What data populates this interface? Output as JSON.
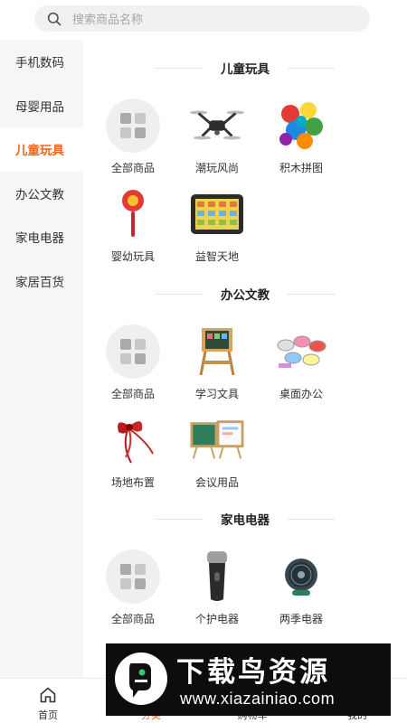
{
  "search": {
    "placeholder": "搜索商品名称",
    "icon": "search-icon"
  },
  "sidebar": {
    "items": [
      {
        "label": "手机数码"
      },
      {
        "label": "母婴用品"
      },
      {
        "label": "儿童玩具",
        "active": true
      },
      {
        "label": "办公文教"
      },
      {
        "label": "家电电器"
      },
      {
        "label": "家居百货"
      }
    ]
  },
  "sections": [
    {
      "title": "儿童玩具",
      "items": [
        {
          "label": "全部商品",
          "icon": "grid-icon"
        },
        {
          "label": "潮玩风尚",
          "icon": "drone-image"
        },
        {
          "label": "积木拼图",
          "icon": "blocks-image"
        },
        {
          "label": "婴幼玩具",
          "icon": "rattle-image"
        },
        {
          "label": "益智天地",
          "icon": "learning-pad-image"
        }
      ]
    },
    {
      "title": "办公文教",
      "items": [
        {
          "label": "全部商品",
          "icon": "grid-icon"
        },
        {
          "label": "学习文具",
          "icon": "easel-image"
        },
        {
          "label": "桌面办公",
          "icon": "tape-set-image"
        },
        {
          "label": "场地布置",
          "icon": "ribbon-image"
        },
        {
          "label": "会议用品",
          "icon": "whiteboard-image"
        }
      ]
    },
    {
      "title": "家电电器",
      "items": [
        {
          "label": "全部商品",
          "icon": "grid-icon"
        },
        {
          "label": "个护电器",
          "icon": "shaver-image"
        },
        {
          "label": "两季电器",
          "icon": "fan-image"
        }
      ]
    }
  ],
  "tabbar": {
    "items": [
      {
        "label": "首页",
        "icon": "home-icon"
      },
      {
        "label": "分类",
        "icon": "category-icon",
        "active": true
      },
      {
        "label": "购物车",
        "icon": "cart-icon"
      },
      {
        "label": "我的",
        "icon": "user-icon"
      }
    ]
  },
  "watermark": {
    "title": "下载鸟资源",
    "url": "www.xiazainiao.com"
  },
  "colors": {
    "accent": "#f0641e",
    "sidebar_bg": "#f6f6f6",
    "search_bg": "#f1f1f1"
  }
}
